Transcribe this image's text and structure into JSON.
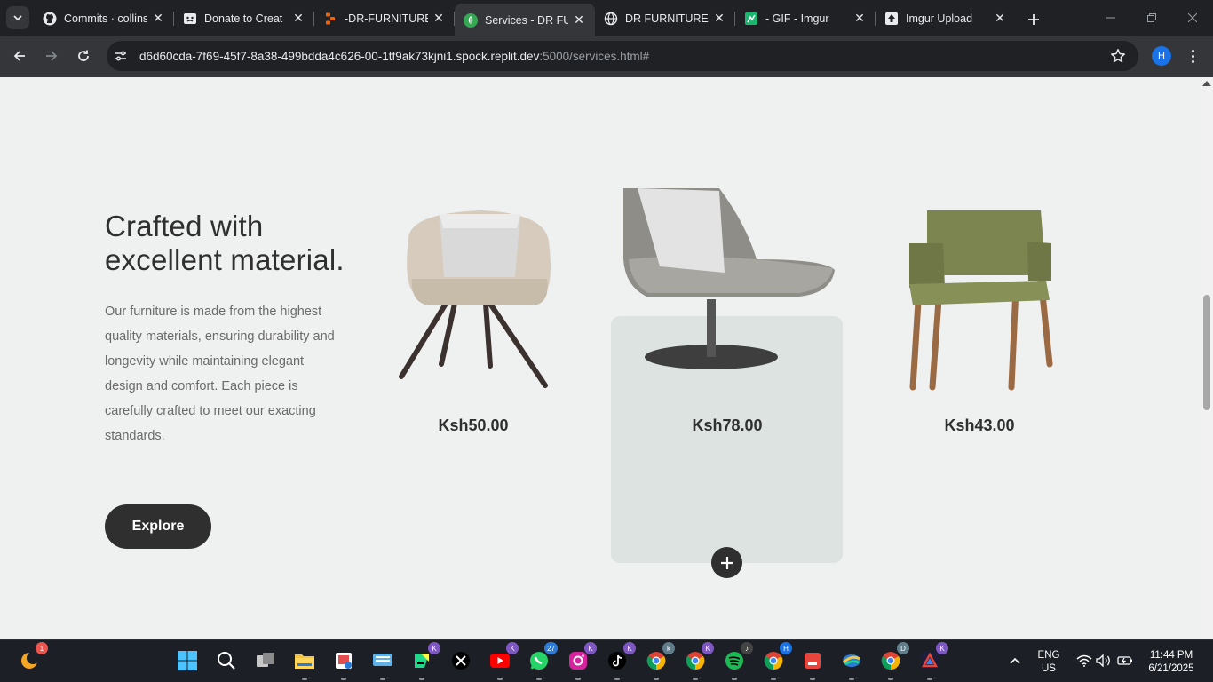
{
  "browser": {
    "tabs": [
      {
        "title": "Commits · collins",
        "icon": "github-icon"
      },
      {
        "title": "Donate to Creat",
        "icon": "face-icon"
      },
      {
        "title": "-DR-FURNITURE",
        "icon": "replit-icon"
      },
      {
        "title": "Services - DR FU",
        "icon": "leaf-icon",
        "active": true
      },
      {
        "title": "DR FURNITURE",
        "icon": "globe-icon"
      },
      {
        "title": "- GIF - Imgur",
        "icon": "imgur-gif-icon"
      },
      {
        "title": "Imgur Upload",
        "icon": "upload-icon"
      }
    ],
    "url_main": "d6d60cda-7f69-45f7-8a38-499bdda4c626-00-1tf9ak73kjni1.spock.replit.dev",
    "url_rest": ":5000/services.html#",
    "profile_initial": "H"
  },
  "page": {
    "heading": "Crafted with excellent material.",
    "description": "Our furniture is made from the highest quality materials, ensuring durability and longevity while maintaining elegant design and comfort. Each piece is carefully crafted to meet our exacting standards.",
    "explore_label": "Explore",
    "products": [
      {
        "price": "Ksh50.00"
      },
      {
        "price": "Ksh78.00"
      },
      {
        "price": "Ksh43.00"
      }
    ]
  },
  "taskbar": {
    "badges": {
      "weather": "1",
      "app_k": "K",
      "whatsapp": "27",
      "chrome_d": "D",
      "chrome_h": "H"
    },
    "language_line1": "ENG",
    "language_line2": "US",
    "time": "11:44 PM",
    "date": "6/21/2025"
  },
  "colors": {
    "page_bg": "#eff1f0",
    "card_hover_bg": "#dce3e1",
    "button_bg": "#2f2f2f"
  }
}
